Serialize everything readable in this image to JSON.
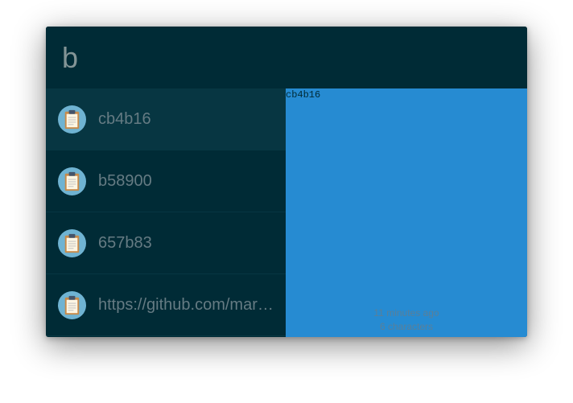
{
  "search": {
    "value": "b"
  },
  "results": [
    {
      "label": "cb4b16",
      "icon": "clipboard-icon",
      "selected": true
    },
    {
      "label": "b58900",
      "icon": "clipboard-icon",
      "selected": false
    },
    {
      "label": "657b83",
      "icon": "clipboard-icon",
      "selected": false
    },
    {
      "label": "https://github.com/mar…",
      "icon": "clipboard-icon",
      "selected": false
    }
  ],
  "preview": {
    "content": "cb4b16",
    "time_ago": "11 minutes ago",
    "chars": "6 characters"
  },
  "colors": {
    "window_bg": "#002b36",
    "selected_bg": "#073642",
    "preview_bg": "#268bd2",
    "text": "#657b83",
    "icon_circle": "#6fb3d2"
  }
}
